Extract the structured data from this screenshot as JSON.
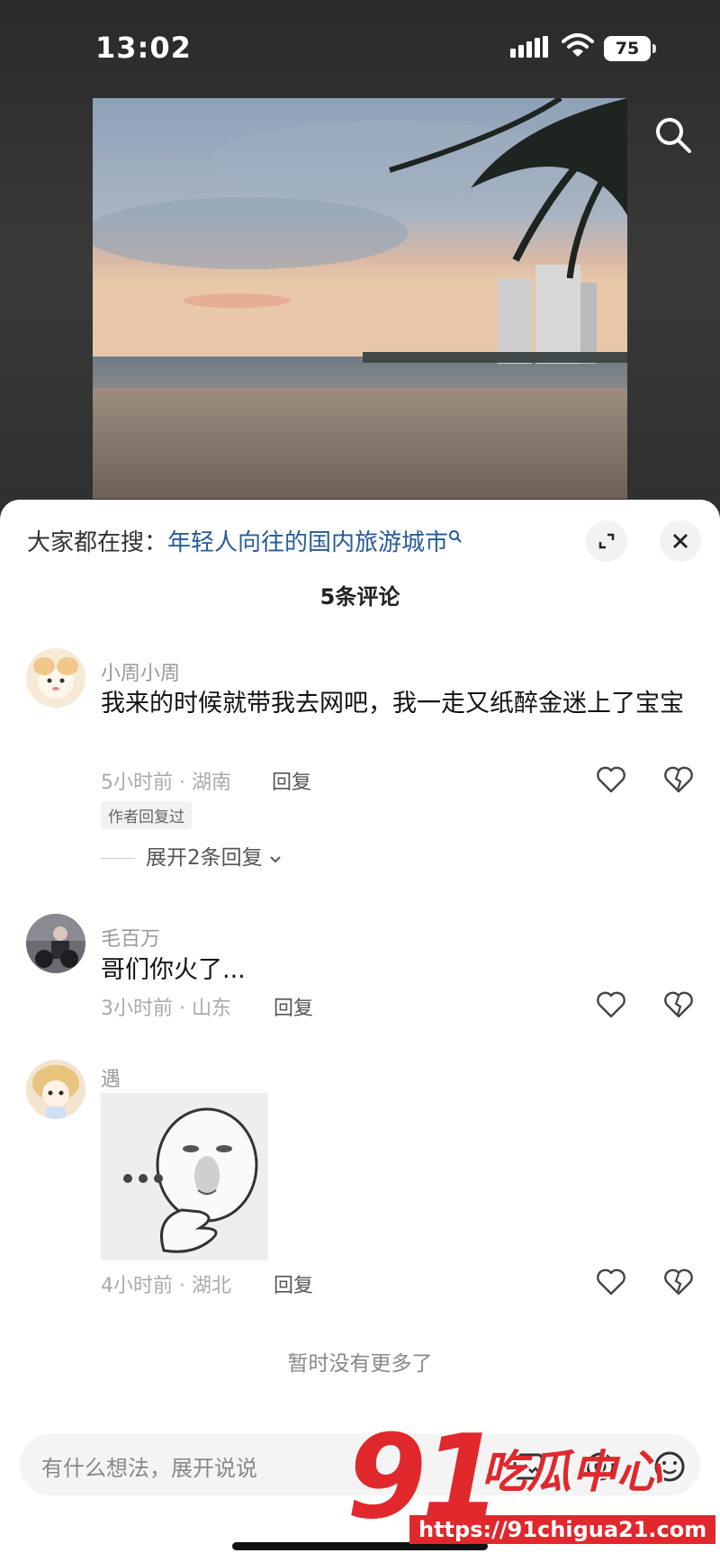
{
  "status_bar": {
    "time": "13:02",
    "battery": "75"
  },
  "trending": {
    "prefix": "大家都在搜：",
    "query": "年轻人向往的国内旅游城市"
  },
  "comment_count": "5条评论",
  "comments": [
    {
      "name": "小周小周",
      "text": "我来的时候就带我去网吧，我一走又纸醉金迷上了宝宝",
      "meta": "5小时前 · 湖南",
      "reply": "回复",
      "author_tag": "作者回复过",
      "expand": "展开2条回复"
    },
    {
      "name": "毛百万",
      "text": "哥们你火了...",
      "meta": "3小时前 · 山东",
      "reply": "回复"
    },
    {
      "name": "遇",
      "meta": "4小时前 · 湖北",
      "reply": "回复"
    }
  ],
  "no_more": "暂时没有更多了",
  "input": {
    "placeholder": "有什么想法，展开说说"
  },
  "watermark": {
    "number": "91",
    "brand": "吃瓜中心",
    "url": "https://91chigua21.com"
  }
}
